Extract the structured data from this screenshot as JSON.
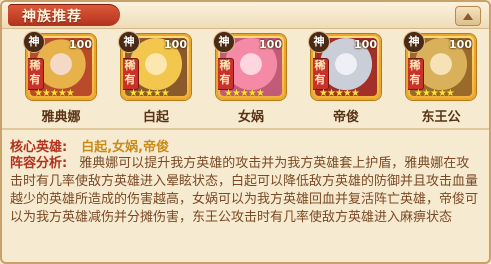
{
  "header": {
    "title": "神族推荐",
    "collapse_icon": "chevron-up-icon"
  },
  "heroes": [
    {
      "tier": "神",
      "level": "100",
      "rarity": "稀有",
      "stars": "★★★★★",
      "name": "雅典娜",
      "colors": [
        "#f3d9c6",
        "#e7b24a",
        "#b94a2a"
      ]
    },
    {
      "tier": "神",
      "level": "100",
      "rarity": "稀有",
      "stars": "★★★★★",
      "name": "白起",
      "colors": [
        "#fde7b0",
        "#f3c64d",
        "#8a5a2a"
      ]
    },
    {
      "tier": "神",
      "level": "100",
      "rarity": "稀有",
      "stars": "★★★★★",
      "name": "女娲",
      "colors": [
        "#ffd6e0",
        "#f48aa6",
        "#c25b7a"
      ]
    },
    {
      "tier": "神",
      "level": "100",
      "rarity": "稀有",
      "stars": "★★★★★",
      "name": "帝俊",
      "colors": [
        "#eef0f6",
        "#c9ced8",
        "#a33028"
      ]
    },
    {
      "tier": "神",
      "level": "100",
      "rarity": "稀有",
      "stars": "★★★★★",
      "name": "东王公",
      "colors": [
        "#f7e2b8",
        "#d9b15a",
        "#9a6a2a"
      ]
    }
  ],
  "core": {
    "label": "核心英雄:",
    "value": "白起,女娲,帝俊"
  },
  "analysis": {
    "label": "阵容分析:",
    "text": "雅典娜可以提升我方英雄的攻击并为我方英雄套上护盾，雅典娜在攻击时有几率使敌方英雄进入晕眩状态，白起可以降低敌方英雄的防御并且攻击血量越少的英雄所造成的伤害越高，女娲可以为我方英雄回血并复活阵亡英雄，帝俊可以为我方英雄减伤并分摊伤害，东王公攻击时有几率使敌方英雄进入麻痹状态"
  }
}
